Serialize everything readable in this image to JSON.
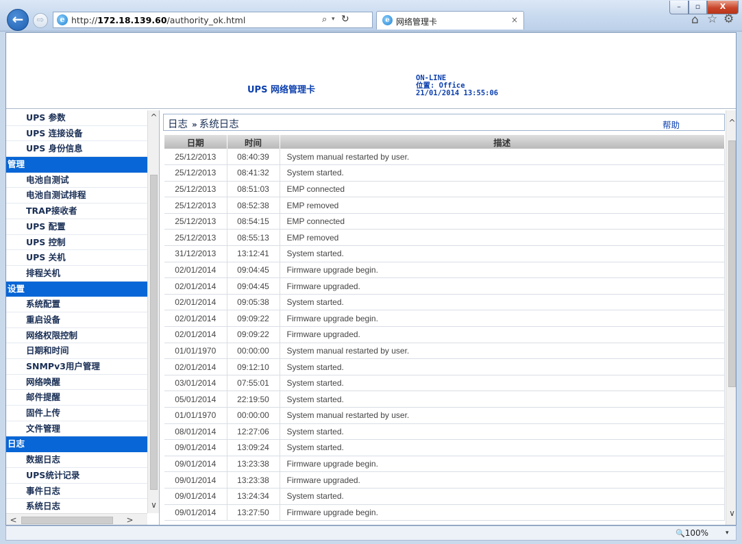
{
  "browser": {
    "url_prefix": "http://",
    "url_host": "172.18.139.60",
    "url_path": "/authority_ok.html",
    "tab_title": "网络管理卡",
    "tab_close": "×",
    "back_glyph": "←",
    "forward_glyph": "⇨",
    "search_glyph": "⌕",
    "dropdown_glyph": "▾",
    "refresh_glyph": "↻",
    "home_glyph": "⌂",
    "star_glyph": "☆",
    "gear_glyph": "⚙",
    "window": {
      "minimize": "–",
      "maximize": "▫",
      "close": "X"
    },
    "icons": [
      "back-icon",
      "forward-icon",
      "ie-icon",
      "search-icon",
      "refresh-icon",
      "home-icon",
      "star-icon",
      "gear-icon"
    ]
  },
  "header": {
    "product_title": "UPS 网络管理卡",
    "status": "ON-LINE",
    "location": "位置: Office",
    "datetime": "21/01/2014 13:55:06"
  },
  "sidebar": {
    "items": [
      {
        "label": "UPS 参数",
        "type": "item"
      },
      {
        "label": "UPS 连接设备",
        "type": "item"
      },
      {
        "label": "UPS 身份信息",
        "type": "item"
      },
      {
        "label": "管理",
        "type": "header"
      },
      {
        "label": "电池自测试",
        "type": "item"
      },
      {
        "label": "电池自测试排程",
        "type": "item"
      },
      {
        "label": "TRAP接收者",
        "type": "item"
      },
      {
        "label": "UPS 配置",
        "type": "item"
      },
      {
        "label": "UPS 控制",
        "type": "item"
      },
      {
        "label": "UPS 关机",
        "type": "item"
      },
      {
        "label": "排程关机",
        "type": "item"
      },
      {
        "label": "设置",
        "type": "header"
      },
      {
        "label": "系统配置",
        "type": "item"
      },
      {
        "label": "重启设备",
        "type": "item"
      },
      {
        "label": "网络权限控制",
        "type": "item"
      },
      {
        "label": "日期和时间",
        "type": "item"
      },
      {
        "label": "SNMPv3用户管理",
        "type": "item"
      },
      {
        "label": "网络唤醒",
        "type": "item"
      },
      {
        "label": "邮件提醒",
        "type": "item"
      },
      {
        "label": "固件上传",
        "type": "item"
      },
      {
        "label": "文件管理",
        "type": "item"
      },
      {
        "label": "日志",
        "type": "header"
      },
      {
        "label": "数据日志",
        "type": "item"
      },
      {
        "label": "UPS统计记录",
        "type": "item"
      },
      {
        "label": "事件日志",
        "type": "item"
      },
      {
        "label": "系统日志",
        "type": "item"
      }
    ],
    "scroll_up": "^",
    "scroll_down": "∨",
    "scroll_left": "<",
    "scroll_right": ">"
  },
  "main": {
    "breadcrumb_section": "日志",
    "breadcrumb_sep": "»",
    "breadcrumb_page": "系统日志",
    "help_label": "帮助",
    "columns": [
      "日期",
      "时间",
      "描述"
    ],
    "rows": [
      [
        "25/12/2013",
        "08:40:39",
        "System manual restarted by user."
      ],
      [
        "25/12/2013",
        "08:41:32",
        "System started."
      ],
      [
        "25/12/2013",
        "08:51:03",
        "EMP connected"
      ],
      [
        "25/12/2013",
        "08:52:38",
        "EMP removed"
      ],
      [
        "25/12/2013",
        "08:54:15",
        "EMP connected"
      ],
      [
        "25/12/2013",
        "08:55:13",
        "EMP removed"
      ],
      [
        "31/12/2013",
        "13:12:41",
        "System started."
      ],
      [
        "02/01/2014",
        "09:04:45",
        "Firmware upgrade begin."
      ],
      [
        "02/01/2014",
        "09:04:45",
        "Firmware upgraded."
      ],
      [
        "02/01/2014",
        "09:05:38",
        "System started."
      ],
      [
        "02/01/2014",
        "09:09:22",
        "Firmware upgrade begin."
      ],
      [
        "02/01/2014",
        "09:09:22",
        "Firmware upgraded."
      ],
      [
        "01/01/1970",
        "00:00:00",
        "System manual restarted by user."
      ],
      [
        "02/01/2014",
        "09:12:10",
        "System started."
      ],
      [
        "03/01/2014",
        "07:55:01",
        "System started."
      ],
      [
        "05/01/2014",
        "22:19:50",
        "System started."
      ],
      [
        "01/01/1970",
        "00:00:00",
        "System manual restarted by user."
      ],
      [
        "08/01/2014",
        "12:27:06",
        "System started."
      ],
      [
        "09/01/2014",
        "13:09:24",
        "System started."
      ],
      [
        "09/01/2014",
        "13:23:38",
        "Firmware upgrade begin."
      ],
      [
        "09/01/2014",
        "13:23:38",
        "Firmware upgraded."
      ],
      [
        "09/01/2014",
        "13:24:34",
        "System started."
      ],
      [
        "09/01/2014",
        "13:27:50",
        "Firmware upgrade begin."
      ]
    ]
  },
  "statusbar": {
    "zoom": "100%",
    "zoom_glyph": "🔍",
    "dropdown_glyph": "▾"
  },
  "colors": {
    "menu_header_bg": "#0866d6",
    "title_text": "#0b3fae",
    "table_header_bg": "#c4c4c4"
  }
}
